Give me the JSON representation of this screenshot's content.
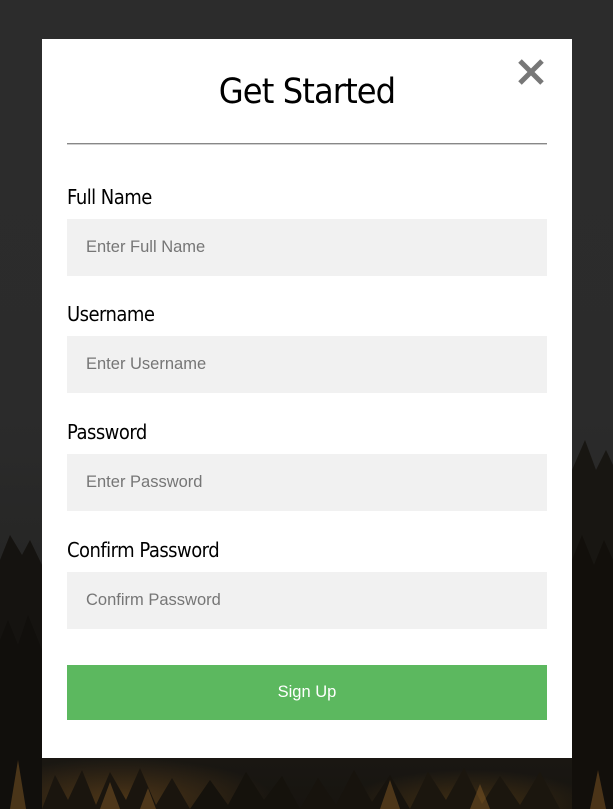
{
  "modal": {
    "title": "Get Started",
    "close_icon": "close-icon",
    "submit_label": "Sign Up"
  },
  "fields": [
    {
      "label": "Full Name",
      "placeholder": "Enter Full Name",
      "value": ""
    },
    {
      "label": "Username",
      "placeholder": "Enter Username",
      "value": ""
    },
    {
      "label": "Password",
      "placeholder": "Enter Password",
      "value": ""
    },
    {
      "label": "Confirm Password",
      "placeholder": "Confirm Password",
      "value": ""
    }
  ],
  "colors": {
    "backdrop": "#2a2a2a",
    "modal_background": "#ffffff",
    "input_background": "#f1f1f1",
    "button_background": "#5cb85f",
    "button_text": "#ffffff",
    "close_icon": "#777777"
  }
}
